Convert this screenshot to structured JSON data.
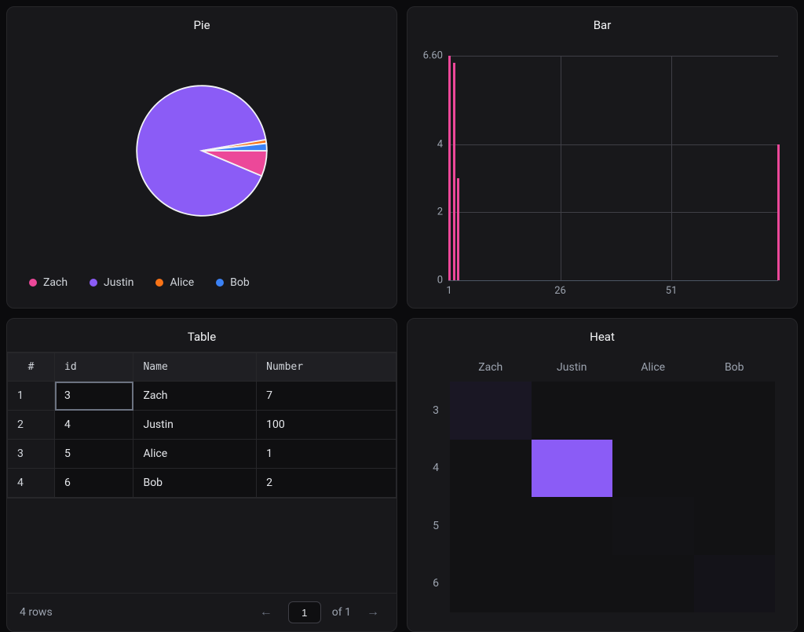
{
  "pie": {
    "title": "Pie",
    "legend": [
      {
        "label": "Zach",
        "color": "#ec4899"
      },
      {
        "label": "Justin",
        "color": "#8b5cf6"
      },
      {
        "label": "Alice",
        "color": "#f97316"
      },
      {
        "label": "Bob",
        "color": "#3b82f6"
      }
    ]
  },
  "bar": {
    "title": "Bar",
    "yticks": [
      "6.60",
      "4",
      "2",
      "0"
    ],
    "xticks": [
      "1",
      "26",
      "51"
    ]
  },
  "table": {
    "title": "Table",
    "headers": [
      "#",
      "id",
      "Name",
      "Number"
    ],
    "rows": [
      {
        "n": "1",
        "id": "3",
        "name": "Zach",
        "number": "7"
      },
      {
        "n": "2",
        "id": "4",
        "name": "Justin",
        "number": "100"
      },
      {
        "n": "3",
        "id": "5",
        "name": "Alice",
        "number": "1"
      },
      {
        "n": "4",
        "id": "6",
        "name": "Bob",
        "number": "2"
      }
    ],
    "footer": {
      "rows_label": "4 rows",
      "page": "1",
      "of_label": "of 1"
    }
  },
  "heat": {
    "title": "Heat",
    "col_labels": [
      "Zach",
      "Justin",
      "Alice",
      "Bob"
    ],
    "row_labels": [
      "3",
      "4",
      "5",
      "6"
    ]
  },
  "chart_data": [
    {
      "type": "pie",
      "title": "Pie",
      "series": [
        {
          "name": "Zach",
          "value": 7,
          "color": "#ec4899"
        },
        {
          "name": "Justin",
          "value": 100,
          "color": "#8b5cf6"
        },
        {
          "name": "Alice",
          "value": 1,
          "color": "#f97316"
        },
        {
          "name": "Bob",
          "value": 2,
          "color": "#3b82f6"
        }
      ]
    },
    {
      "type": "bar",
      "title": "Bar",
      "x": [
        1,
        2,
        3,
        75
      ],
      "values": [
        6.6,
        6.4,
        3.0,
        4.0
      ],
      "xlabel": "",
      "ylabel": "",
      "xlim": [
        1,
        75
      ],
      "ylim": [
        0,
        6.6
      ],
      "xticks": [
        1,
        26,
        51
      ],
      "yticks": [
        0,
        2,
        4,
        6.6
      ],
      "color": "#ec4899"
    },
    {
      "type": "table",
      "title": "Table",
      "columns": [
        "#",
        "id",
        "Name",
        "Number"
      ],
      "rows": [
        [
          1,
          3,
          "Zach",
          7
        ],
        [
          2,
          4,
          "Justin",
          100
        ],
        [
          3,
          5,
          "Alice",
          1
        ],
        [
          4,
          6,
          "Bob",
          2
        ]
      ]
    },
    {
      "type": "heatmap",
      "title": "Heat",
      "x_categories": [
        "Zach",
        "Justin",
        "Alice",
        "Bob"
      ],
      "y_categories": [
        "3",
        "4",
        "5",
        "6"
      ],
      "z": [
        [
          7,
          0,
          0,
          0
        ],
        [
          0,
          100,
          0,
          0
        ],
        [
          0,
          0,
          1,
          0
        ],
        [
          0,
          0,
          0,
          2
        ]
      ],
      "zmin": 0,
      "zmax": 100,
      "colorscale": [
        "#121214",
        "#8b5cf6"
      ]
    }
  ]
}
